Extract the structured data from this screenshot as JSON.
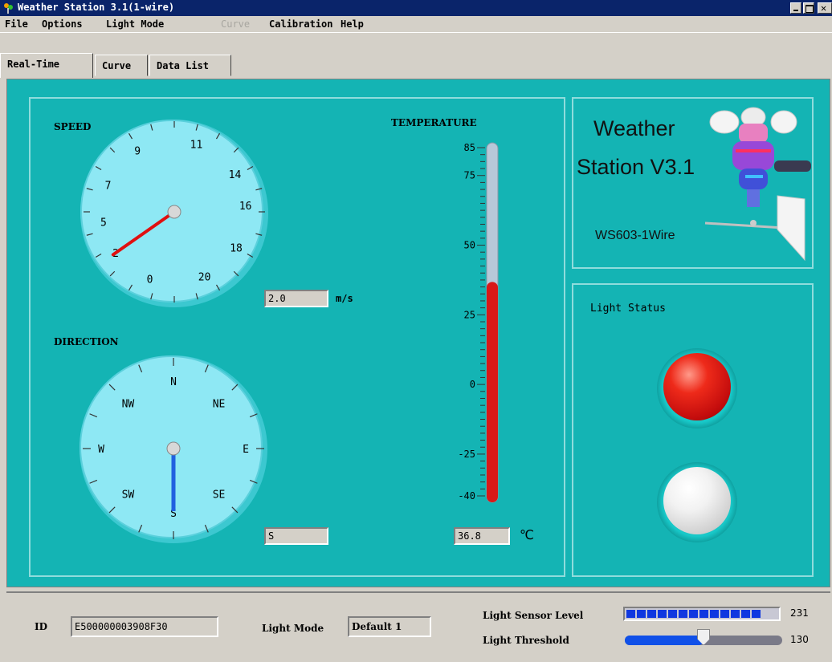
{
  "window": {
    "title": "Weather Station 3.1(1-wire)"
  },
  "menu": [
    {
      "label": "File",
      "enabled": true
    },
    {
      "label": "Options",
      "enabled": true
    },
    {
      "label": "Light Mode",
      "enabled": true
    },
    {
      "label": "Curve",
      "enabled": false
    },
    {
      "label": "Calibration",
      "enabled": true
    },
    {
      "label": "Help",
      "enabled": true
    }
  ],
  "tabs": [
    {
      "label": "Real-Time",
      "active": true
    },
    {
      "label": "Curve",
      "active": false
    },
    {
      "label": "Data List",
      "active": false
    }
  ],
  "speed": {
    "title": "SPEED",
    "scale_labels": [
      "0",
      "2",
      "5",
      "7",
      "9",
      "11",
      "14",
      "16",
      "18",
      "20"
    ],
    "value": "2.0",
    "unit": "m/s"
  },
  "direction": {
    "title": "DIRECTION",
    "labels": [
      "N",
      "NE",
      "E",
      "SE",
      "S",
      "SW",
      "W",
      "NW"
    ],
    "value": "S"
  },
  "temperature": {
    "title": "TEMPERATURE",
    "scale_labels": [
      "85",
      "75",
      "50",
      "25",
      "0",
      "-25",
      "-40"
    ],
    "value": "36.8",
    "unit": "℃"
  },
  "brand": {
    "line1": "Weather",
    "line2": "Station V3.1",
    "model": "WS603-1Wire"
  },
  "light_status": {
    "title": "Light Status",
    "leds": [
      {
        "name": "red",
        "state": "on",
        "color": "#e01010"
      },
      {
        "name": "white",
        "state": "off",
        "color": "#f0f0f0"
      }
    ]
  },
  "footer": {
    "id_label": "ID",
    "id_value": "E500000003908F30",
    "light_mode_label": "Light Mode",
    "light_mode_value": "Default 1",
    "sensor_level_label": "Light Sensor Level",
    "sensor_level_value": "231",
    "sensor_level_fraction": 0.9,
    "threshold_label": "Light Threshold",
    "threshold_value": "130",
    "threshold_fraction": 0.5
  },
  "colors": {
    "panel_bg": "#14b4b4",
    "dial_face": "#8ee8f4",
    "speed_needle": "#e01010",
    "direction_needle": "#2060e0",
    "mercury": "#d81818",
    "title_bar": "#0a246a"
  }
}
